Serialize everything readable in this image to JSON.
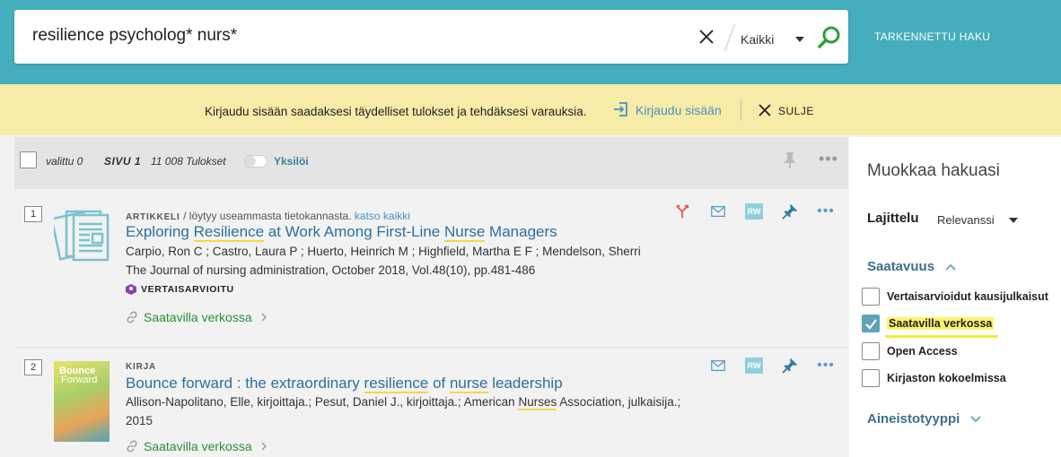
{
  "search": {
    "query": "resilience psycholog* nurs*",
    "scope": "Kaikki",
    "advanced_label": "TARKENNETTU HAKU"
  },
  "banner": {
    "text": "Kirjaudu sisään saadaksesi täydelliset tulokset ja tehdäksesi varauksia.",
    "login_label": "Kirjaudu sisään",
    "close_label": "SULJE"
  },
  "toolbar": {
    "selected": "valittu 0",
    "page": "SIVU 1",
    "count": "11 008 Tulokset",
    "toggle_label": "Yksilöi"
  },
  "results": [
    {
      "number": "1",
      "type": "ARTIKKELI",
      "source": "/ löytyy useammasta tietokannasta.",
      "see_all": "katso kaikki",
      "title_parts": [
        "Exploring ",
        "Resilience",
        " at Work Among First-Line ",
        "Nurse",
        " Managers"
      ],
      "authors": "Carpio, Ron C ; Castro, Laura P ; Huerto, Heinrich M ; Highfield, Martha E F ; Mendelson, Sherri",
      "publication": "The Journal of nursing administration, October 2018, Vol.48(10), pp.481-486",
      "peer_review": "VERTAISARVIOITU",
      "availability": "Saatavilla verkossa",
      "rw": "RW"
    },
    {
      "number": "2",
      "type": "KIRJA",
      "title_parts": [
        "Bounce forward : the extraordinary ",
        "resilience",
        " of ",
        "nurse",
        " leadership"
      ],
      "authors_parts": [
        "Allison-Napolitano, Elle, kirjoittaja.; Pesut, Daniel J., kirjoittaja.; American ",
        "Nurses",
        " Association, julkaisija.;"
      ],
      "year": "2015",
      "availability": "Saatavilla verkossa",
      "rw": "RW",
      "cover_title_1": "Bounce",
      "cover_title_2": "Forward"
    }
  ],
  "sidebar": {
    "title": "Muokkaa hakuasi",
    "sort_label": "Lajittelu",
    "sort_value": "Relevanssi",
    "availability_section": "Saatavuus",
    "facets": [
      {
        "label": "Vertaisarvioidut kausijulkaisut",
        "checked": false
      },
      {
        "label": "Saatavilla verkossa",
        "checked": true
      },
      {
        "label": "Open Access",
        "checked": false
      },
      {
        "label": "Kirjaston kokoelmissa",
        "checked": false
      }
    ],
    "material_section": "Aineistotyyppi"
  },
  "colors": {
    "header": "#44aebc",
    "banner": "#f6eba7",
    "link": "#2d6f9e",
    "available": "#2e8b3d",
    "highlight": "#f1d84a"
  }
}
